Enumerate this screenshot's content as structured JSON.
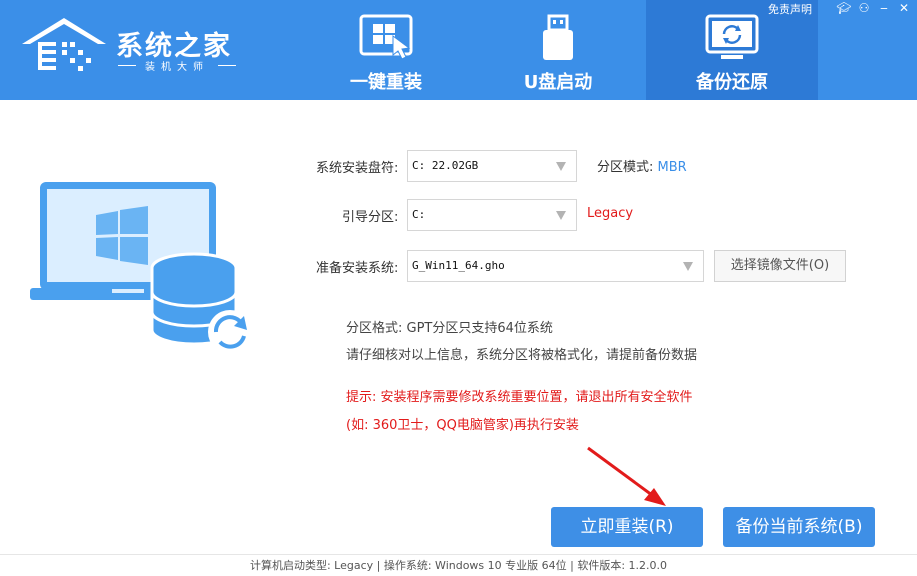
{
  "brand": {
    "title": "系统之家",
    "subtitle": "装机大师"
  },
  "tabs": [
    {
      "label": "一键重装",
      "icon": "windows-install-icon",
      "active": false
    },
    {
      "label": "U盘启动",
      "icon": "usb-drive-icon",
      "active": false
    },
    {
      "label": "备份还原",
      "icon": "backup-restore-icon",
      "active": true
    }
  ],
  "top_bar": {
    "disclaimer": "免责声明"
  },
  "form": {
    "system_disk_label": "系统安装盘符:",
    "system_disk_value": "C: 22.02GB",
    "partition_mode_label": "分区模式:",
    "partition_mode_value": "MBR",
    "boot_partition_label": "引导分区:",
    "boot_partition_value": "C:",
    "boot_mode_value": "Legacy",
    "system_image_label": "准备安装系统:",
    "system_image_value": "G_Win11_64.gho",
    "browse_button": "选择镜像文件(O)"
  },
  "notes": {
    "partition_format": "分区格式:  GPT分区只支持64位系统",
    "confirm": "请仔细核对以上信息，系统分区将被格式化，请提前备份数据",
    "warning_line1": "提示:  安装程序需要修改系统重要位置，请退出所有安全软件",
    "warning_line2": "(如:  360卫士，QQ电脑管家)再执行安装"
  },
  "buttons": {
    "reinstall": "立即重装(R)",
    "backup": "备份当前系统(B)"
  },
  "footer": "计算机启动类型:  Legacy | 操作系统:  Windows 10 专业版 64位 | 软件版本:  1.2.0.0",
  "colors": {
    "header": "#3b8fe8",
    "active_tab": "#2d7ad6",
    "accent": "#3e8fe6",
    "warning": "#e21b1b",
    "link": "#3b8fe8"
  }
}
